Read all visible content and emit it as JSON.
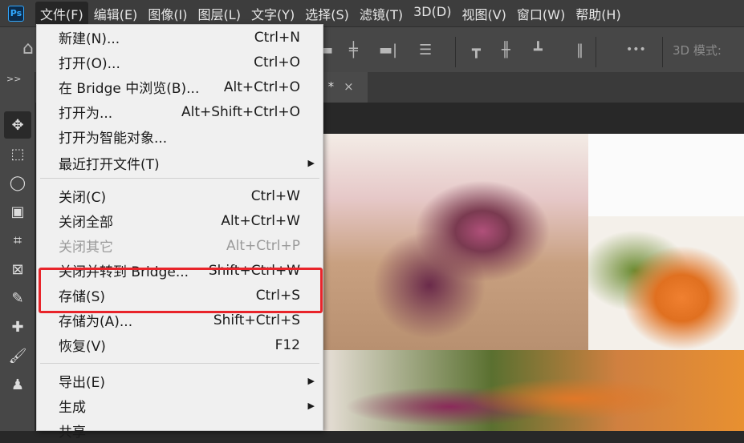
{
  "app": {
    "logo": "Ps"
  },
  "menubar": [
    "文件(F)",
    "编辑(E)",
    "图像(I)",
    "图层(L)",
    "文字(Y)",
    "选择(S)",
    "滤镜(T)",
    "3D(D)",
    "视图(V)",
    "窗口(W)",
    "帮助(H)"
  ],
  "options": {
    "mode_label": "3D 模式:",
    "more": "•••"
  },
  "tab": {
    "title_tail": ") *",
    "close": "×"
  },
  "tools": {
    "collapse": ">>"
  },
  "file_menu": [
    {
      "label": "新建(N)...",
      "shortcut": "Ctrl+N"
    },
    {
      "label": "打开(O)...",
      "shortcut": "Ctrl+O"
    },
    {
      "label": "在 Bridge 中浏览(B)...",
      "shortcut": "Alt+Ctrl+O"
    },
    {
      "label": "打开为...",
      "shortcut": "Alt+Shift+Ctrl+O"
    },
    {
      "label": "打开为智能对象...",
      "shortcut": ""
    },
    {
      "label": "最近打开文件(T)",
      "shortcut": "",
      "submenu": true
    },
    {
      "label": "关闭(C)",
      "shortcut": "Ctrl+W"
    },
    {
      "label": "关闭全部",
      "shortcut": "Alt+Ctrl+W"
    },
    {
      "label": "关闭其它",
      "shortcut": "Alt+Ctrl+P",
      "disabled": true
    },
    {
      "label": "关闭并转到 Bridge...",
      "shortcut": "Shift+Ctrl+W"
    },
    {
      "label": "存储(S)",
      "shortcut": "Ctrl+S",
      "highlighted": true
    },
    {
      "label": "存储为(A)...",
      "shortcut": "Shift+Ctrl+S"
    },
    {
      "label": "恢复(V)",
      "shortcut": "F12"
    },
    {
      "label": "导出(E)",
      "shortcut": "",
      "submenu": true
    },
    {
      "label": "生成",
      "shortcut": "",
      "submenu": true
    },
    {
      "label": "共享",
      "shortcut": ""
    }
  ],
  "colors": {
    "highlight_box": "#e8242a",
    "menu_bg": "#f0f0f0"
  }
}
